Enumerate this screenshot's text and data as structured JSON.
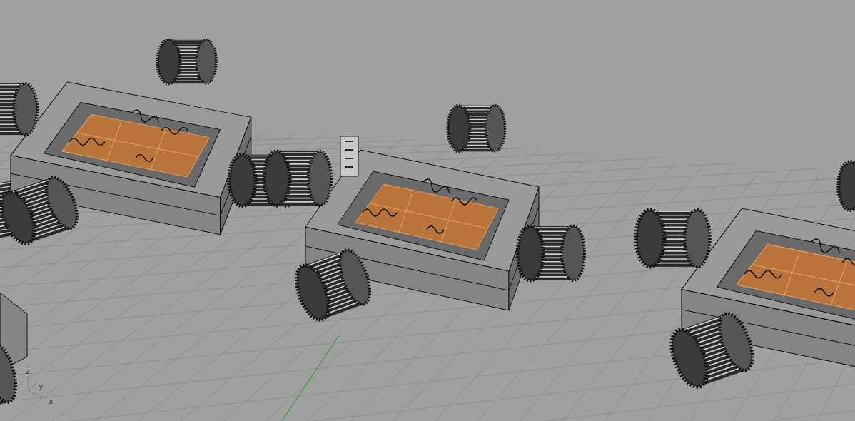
{
  "viewport": {
    "axis_labels": [
      "x",
      "y",
      "z"
    ]
  }
}
